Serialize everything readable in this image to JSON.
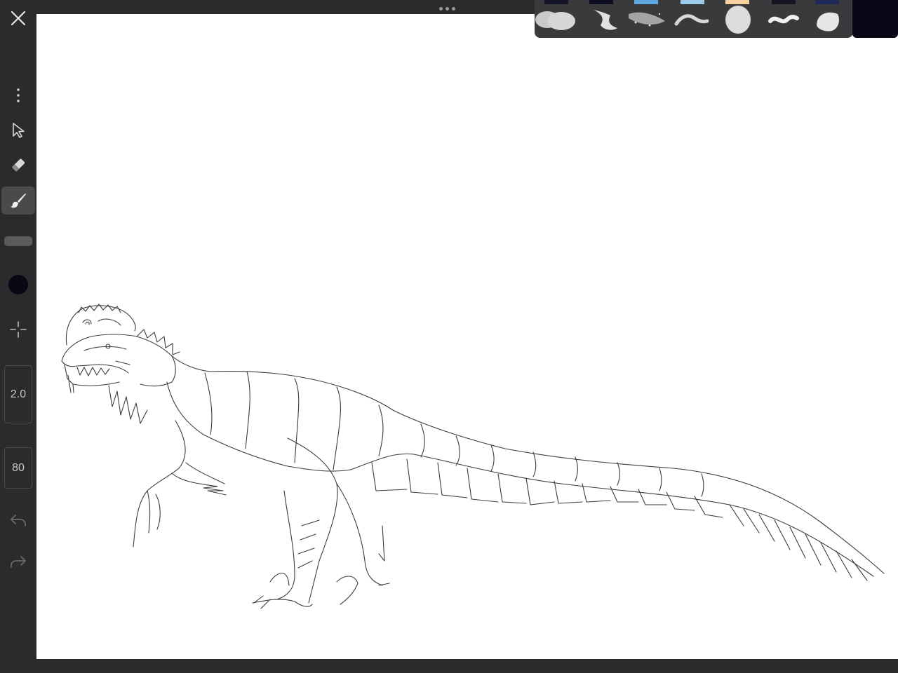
{
  "toolbar": {
    "close_icon": "close-icon",
    "more_icon": "more-vertical-icon",
    "select_icon": "cursor-arrow-icon",
    "eraser_icon": "eraser-icon",
    "brush_icon": "brush-icon",
    "crosshair_icon": "crosshair-icon",
    "undo_icon": "undo-icon",
    "redo_icon": "redo-icon",
    "brush_size": "2.0",
    "brush_opacity": "80",
    "current_color": "#0a0814"
  },
  "brush_panel": {
    "color_chips": [
      "#141428",
      "#0e0e22",
      "#5ca6dc",
      "#9ccbe8",
      "#f6d2a0",
      "#141420",
      "#1e2a5a"
    ],
    "brushes": [
      "cloud-brush",
      "fan-brush",
      "splatter-brush",
      "dry-ink-brush",
      "soft-airbrush",
      "ribbon-brush",
      "shell-brush"
    ],
    "current_brush_color": "#0b0716"
  },
  "canvas": {
    "background": "#ffffff",
    "drawing": "dinosaur-line-art"
  }
}
